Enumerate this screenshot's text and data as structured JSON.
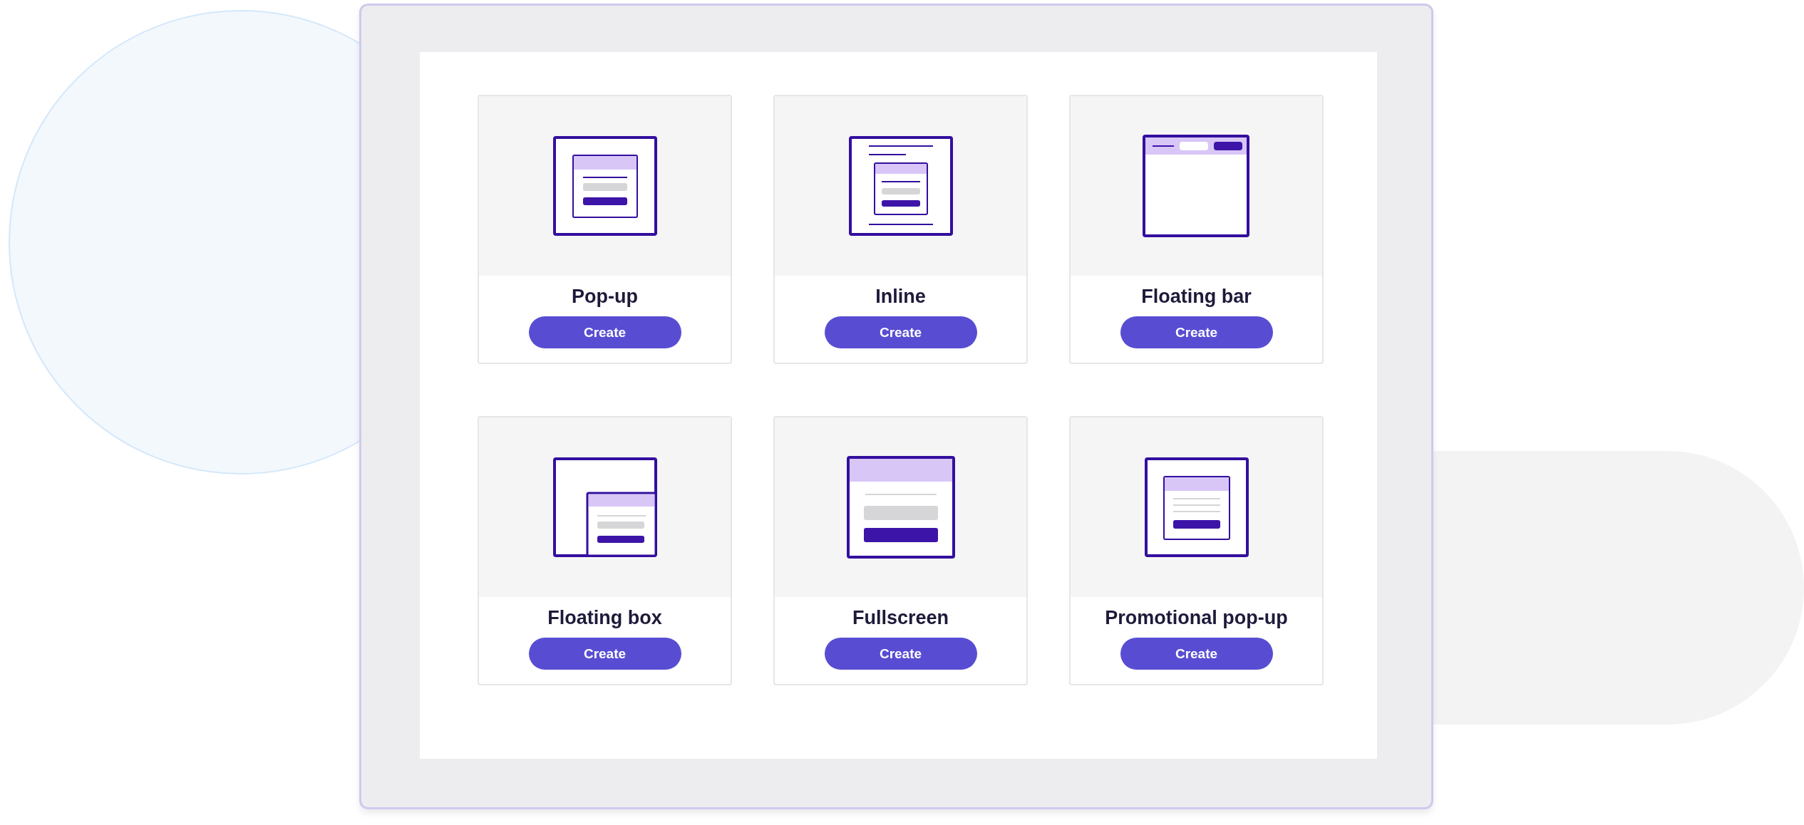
{
  "cards": [
    {
      "kind": "popup",
      "title": "Pop-up",
      "button": "Create"
    },
    {
      "kind": "inline",
      "title": "Inline",
      "button": "Create"
    },
    {
      "kind": "bar",
      "title": "Floating bar",
      "button": "Create"
    },
    {
      "kind": "box",
      "title": "Floating box",
      "button": "Create"
    },
    {
      "kind": "fullscreen",
      "title": "Fullscreen",
      "button": "Create"
    },
    {
      "kind": "promo",
      "title": "Promotional pop-up",
      "button": "Create"
    }
  ]
}
